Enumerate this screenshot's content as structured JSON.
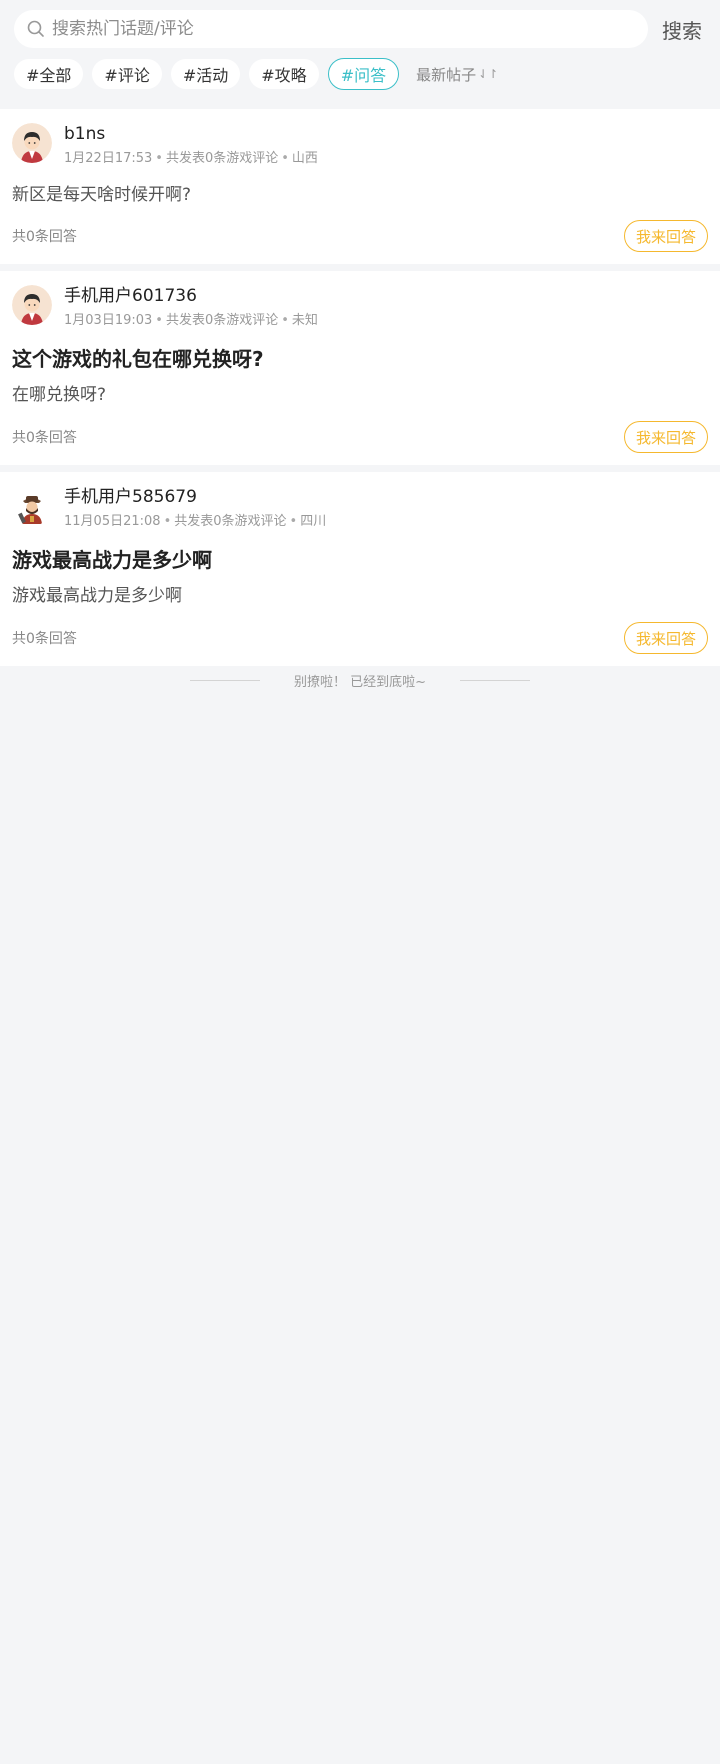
{
  "search": {
    "placeholder": "搜索热门话题/评论",
    "button_label": "搜索"
  },
  "tabs": [
    {
      "label": "#全部",
      "active": false
    },
    {
      "label": "#评论",
      "active": false
    },
    {
      "label": "#活动",
      "active": false
    },
    {
      "label": "#攻略",
      "active": false
    },
    {
      "label": "#问答",
      "active": true
    }
  ],
  "sort": {
    "label": "最新帖子",
    "icon": "sort-arrows-icon"
  },
  "posts": [
    {
      "username": "b1ns",
      "avatar": "avatar-boy-red",
      "time": "1月22日17:53",
      "stats": "共发表0条游戏评论",
      "location": "山西",
      "title": "",
      "body": "新区是每天啥时候开啊?",
      "answer_count": "共0条回答",
      "answer_button": "我来回答"
    },
    {
      "username": "手机用户601736",
      "avatar": "avatar-boy-red",
      "time": "1月03日19:03",
      "stats": "共发表0条游戏评论",
      "location": "未知",
      "title": "这个游戏的礼包在哪兑换呀?",
      "body": "在哪兑换呀?",
      "answer_count": "共0条回答",
      "answer_button": "我来回答"
    },
    {
      "username": "手机用户585679",
      "avatar": "avatar-warrior",
      "time": "11月05日21:08",
      "stats": "共发表0条游戏评论",
      "location": "四川",
      "title": "游戏最高战力是多少啊",
      "body": "游戏最高战力是多少啊",
      "answer_count": "共0条回答",
      "answer_button": "我来回答"
    }
  ],
  "footer": {
    "end_text": "别撩啦！ 已经到底啦~"
  },
  "colors": {
    "accent": "#3bbfc8",
    "answer": "#f5b82e",
    "background": "#f4f5f7"
  }
}
